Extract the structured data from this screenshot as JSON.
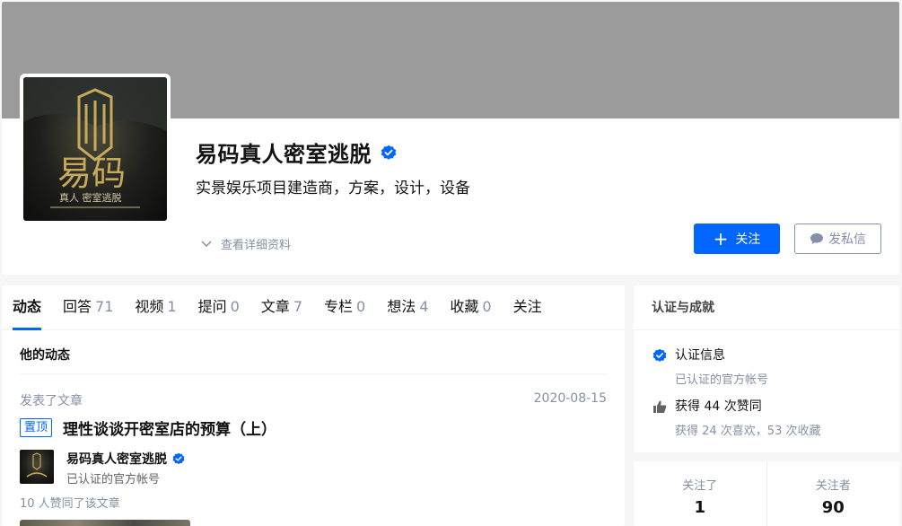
{
  "profile": {
    "name": "易码真人密室逃脱",
    "headline": "实景娱乐项目建造商，方案，设计，设备",
    "details_toggle": "查看详细资料",
    "follow_button": "关注",
    "message_button": "发私信",
    "avatar_text": "易码",
    "avatar_subtext": "真人 密室逃脱"
  },
  "tabs": [
    {
      "label": "动态",
      "count": ""
    },
    {
      "label": "回答",
      "count": "71"
    },
    {
      "label": "视频",
      "count": "1"
    },
    {
      "label": "提问",
      "count": "0"
    },
    {
      "label": "文章",
      "count": "7"
    },
    {
      "label": "专栏",
      "count": "0"
    },
    {
      "label": "想法",
      "count": "4"
    },
    {
      "label": "收藏",
      "count": "0"
    },
    {
      "label": "关注",
      "count": ""
    }
  ],
  "activity": {
    "section_title": "他的动态",
    "type": "发表了文章",
    "date": "2020-08-15",
    "pin_badge": "置顶",
    "article_title": "理性谈谈开密室店的预算（上）",
    "author_name": "易码真人密室逃脱",
    "author_title": "已认证的官方帐号",
    "likes_line": "10 人赞同了该文章"
  },
  "achievements": {
    "title": "认证与成就",
    "cert_label": "认证信息",
    "cert_sub": "已认证的官方帐号",
    "likes_label": "获得 44 次赞同",
    "likes_sub": "获得 24 次喜欢，53 次收藏"
  },
  "follow_stats": {
    "following_label": "关注了",
    "following_count": "1",
    "followers_label": "关注者",
    "followers_count": "90"
  },
  "colors": {
    "accent": "#0066ff",
    "muted": "#8590a6",
    "cover": "#9b9b9b"
  }
}
